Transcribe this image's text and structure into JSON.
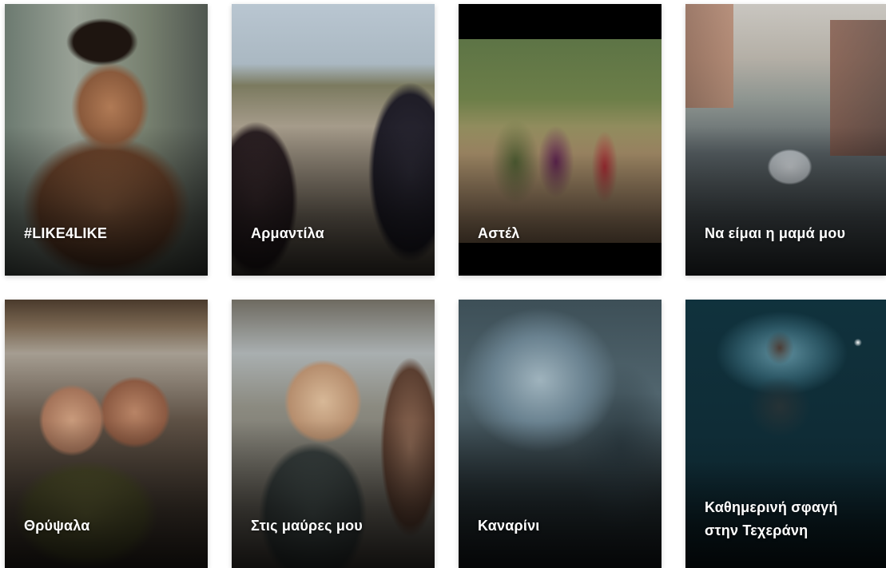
{
  "films": [
    {
      "title": "#LIKE4LIKE"
    },
    {
      "title": "Αρμαντίλα"
    },
    {
      "title": "Αστέλ"
    },
    {
      "title": "Να είμαι η μαμά μου"
    },
    {
      "title": "Θρύψαλα"
    },
    {
      "title": "Στις μαύρες μου"
    },
    {
      "title": "Καναρίνι"
    },
    {
      "title_line1": "Καθημερινή σφαγή",
      "title_line2": "στην Τεχεράνη"
    }
  ]
}
